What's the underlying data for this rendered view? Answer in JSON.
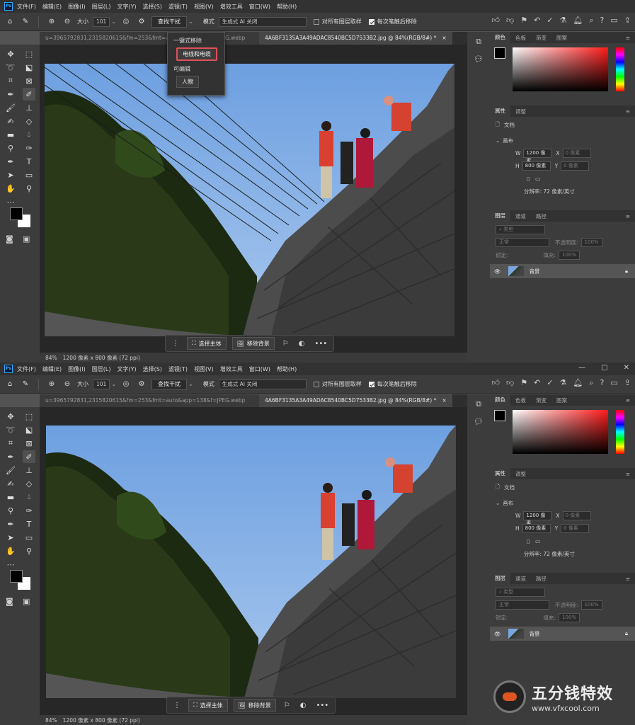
{
  "app": {
    "logo": "Ps"
  },
  "menu": [
    "文件(F)",
    "编辑(E)",
    "图像(I)",
    "图层(L)",
    "文字(Y)",
    "选择(S)",
    "滤镜(T)",
    "视图(V)",
    "增效工具",
    "窗口(W)",
    "帮助(H)"
  ],
  "options": {
    "size_label": "大小",
    "size_value": "101",
    "find_button": "查找干扰",
    "mode_label": "模式",
    "mode_value": "生成式 AI 关闭",
    "sample_all_layers": "对所有图层取样",
    "remove_after_stroke": "每次笔触后移除"
  },
  "tabs": [
    {
      "label": "u=3965792831,2315820615&fm=253&fmt=auto&app=138&f=JPEG.webp",
      "close": "×"
    },
    {
      "label": "4A6BF3135A3A49ADAC8540BC5D7533B2.jpg @ 84%(RGB/8#) *",
      "close": "×"
    }
  ],
  "popup": {
    "section1": "一键式移除",
    "option1": "电线和电缆",
    "section2": "可编辑",
    "option2": "人物"
  },
  "status": {
    "zoom": "84%",
    "dims": "1200 像素 x 800 像素 (72 ppi)"
  },
  "context_bar": {
    "select_subject": "选择主体",
    "remove_background": "移除背景",
    "more": "•••"
  },
  "panels": {
    "color_tabs": [
      "颜色",
      "色板",
      "渐变",
      "图案"
    ],
    "props_tabs": [
      "属性",
      "调整"
    ],
    "doc_label": "文档",
    "canvas_label": "画布",
    "w_label": "W",
    "w_value": "1200 像素",
    "x_label": "X",
    "x_placeholder": "0 像素",
    "h_label": "H",
    "h_value": "800 像素",
    "y_label": "Y",
    "y_placeholder": "0 像素",
    "resolution": "分辨率: 72 像素/英寸",
    "layers_tabs": [
      "图层",
      "通道",
      "路径"
    ],
    "kind_label": "类型",
    "blend_mode": "正常",
    "opacity_label": "不透明度:",
    "opacity_value": "100%",
    "lock_label": "锁定:",
    "fill_label": "填充:",
    "fill_value": "100%",
    "layer_name": "背景"
  },
  "watermark": {
    "name": "五分钱特效",
    "url": "www.vfxcool.com"
  },
  "colors": {
    "accent_highlight": "#e0505a",
    "sky": "#7aa6e0"
  }
}
